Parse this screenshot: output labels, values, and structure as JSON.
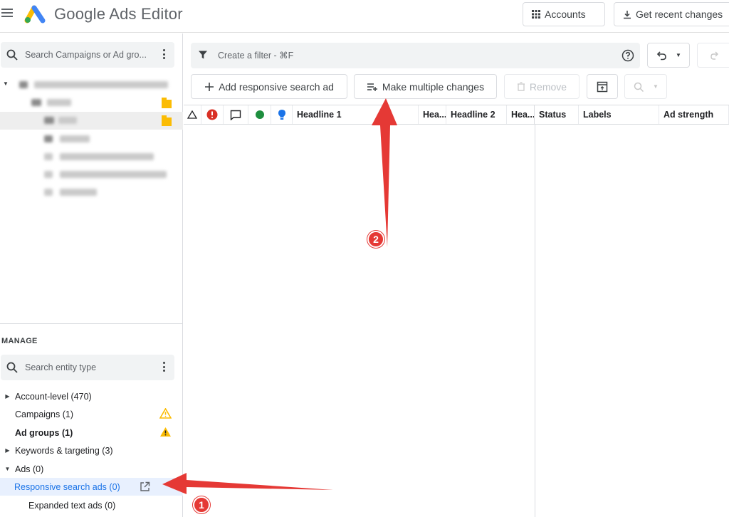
{
  "header": {
    "title": "Google Ads Editor",
    "accounts_label": "Accounts",
    "get_changes_label": "Get recent changes"
  },
  "left": {
    "search_placeholder": "Search Campaigns or Ad gro...",
    "manage_label": "MANAGE",
    "entity_search_placeholder": "Search entity type",
    "entities": [
      {
        "label": "Account-level (470)"
      },
      {
        "label": "Campaigns (1)"
      },
      {
        "label": "Ad groups (1)"
      },
      {
        "label": "Keywords & targeting (3)"
      },
      {
        "label": "Ads (0)"
      },
      {
        "label": "Responsive search ads (0)"
      },
      {
        "label": "Expanded text ads (0)"
      }
    ]
  },
  "toolbar": {
    "filter_placeholder": "Create a filter - ⌘F",
    "add_rsa_label": "Add responsive search ad",
    "make_changes_label": "Make multiple changes",
    "remove_label": "Remove"
  },
  "grid": {
    "columns": {
      "headline1": "Headline 1",
      "hea1": "Hea...",
      "headline2": "Headline 2",
      "hea2": "Hea...",
      "status": "Status",
      "labels": "Labels",
      "ad_strength": "Ad strength"
    }
  },
  "annotations": {
    "step1": "1",
    "step2": "2",
    "color": "#e53935"
  },
  "colors": {
    "accent": "#1a73e8",
    "warning": "#fbbc04",
    "error": "#d93025",
    "success": "#1e8e3e"
  }
}
